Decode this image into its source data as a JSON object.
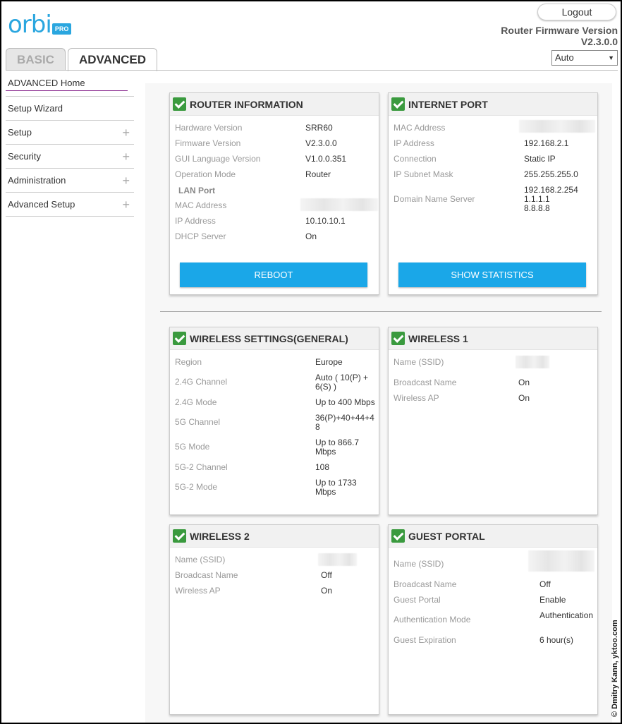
{
  "header": {
    "logo_text": "orbi",
    "logo_badge": "PRO",
    "logout_label": "Logout",
    "firmware_title": "Router Firmware Version",
    "firmware_version": "V2.3.0.0",
    "language_selected": "Auto"
  },
  "tabs": {
    "basic": "BASIC",
    "advanced": "ADVANCED"
  },
  "sidebar": {
    "items": [
      {
        "label": "ADVANCED Home"
      },
      {
        "label": "Setup Wizard"
      },
      {
        "label": "Setup"
      },
      {
        "label": "Security"
      },
      {
        "label": "Administration"
      },
      {
        "label": "Advanced Setup"
      }
    ]
  },
  "router_info": {
    "title": "ROUTER INFORMATION",
    "hardware_label": "Hardware Version",
    "hardware_value": "SRR60",
    "firmware_label": "Firmware Version",
    "firmware_value": "V2.3.0.0",
    "gui_label": "GUI Language Version",
    "gui_value": "V1.0.0.351",
    "mode_label": "Operation Mode",
    "mode_value": "Router",
    "lan_heading": "LAN Port",
    "mac_label": "MAC Address",
    "ip_label": "IP Address",
    "ip_value": "10.10.10.1",
    "dhcp_label": "DHCP Server",
    "dhcp_value": "On",
    "button": "REBOOT"
  },
  "internet_port": {
    "title": "INTERNET PORT",
    "mac_label": "MAC Address",
    "ip_label": "IP Address",
    "ip_value": "192.168.2.1",
    "conn_label": "Connection",
    "conn_value": "Static IP",
    "mask_label": "IP Subnet Mask",
    "mask_value": "255.255.255.0",
    "dns_label": "Domain Name Server",
    "dns_values": [
      "192.168.2.254",
      "1.1.1.1",
      "8.8.8.8"
    ],
    "button": "SHOW STATISTICS"
  },
  "wireless_general": {
    "title": "WIRELESS SETTINGS(GENERAL)",
    "region_label": "Region",
    "region_value": "Europe",
    "ch24_label": "2.4G Channel",
    "ch24_value_1": "Auto ( 10(P) +",
    "ch24_value_2": "6(S) )",
    "mode24_label": "2.4G Mode",
    "mode24_value": "Up to 400 Mbps",
    "ch5_label": "5G Channel",
    "ch5_value_1": "36(P)+40+44+4",
    "ch5_value_2": "8",
    "mode5_label": "5G Mode",
    "mode5_value_1": "Up to 866.7",
    "mode5_value_2": "Mbps",
    "ch52_label": "5G-2 Channel",
    "ch52_value": "108",
    "mode52_label": "5G-2 Mode",
    "mode52_value_1": "Up to 1733",
    "mode52_value_2": "Mbps"
  },
  "wireless1": {
    "title": "WIRELESS 1",
    "ssid_label": "Name (SSID)",
    "broadcast_label": "Broadcast Name",
    "broadcast_value": "On",
    "ap_label": "Wireless AP",
    "ap_value": "On"
  },
  "wireless2": {
    "title": "WIRELESS 2",
    "ssid_label": "Name (SSID)",
    "broadcast_label": "Broadcast Name",
    "broadcast_value": "Off",
    "ap_label": "Wireless AP",
    "ap_value": "On"
  },
  "guest_portal": {
    "title": "GUEST PORTAL",
    "ssid_label": "Name (SSID)",
    "broadcast_label": "Broadcast Name",
    "broadcast_value": "Off",
    "portal_label": "Guest Portal",
    "portal_value": "Enable",
    "auth_label": "Authentication Mode",
    "auth_value": "Authentication",
    "exp_label": "Guest Expiration",
    "exp_value": "6 hour(s)"
  },
  "credit": "© Dmitry Kann, yktoo.com",
  "colors": {
    "accent": "#1aa7e8",
    "logo": "#2aa6df",
    "check": "#3a9a3e",
    "active_underline": "#8a2a8f"
  }
}
